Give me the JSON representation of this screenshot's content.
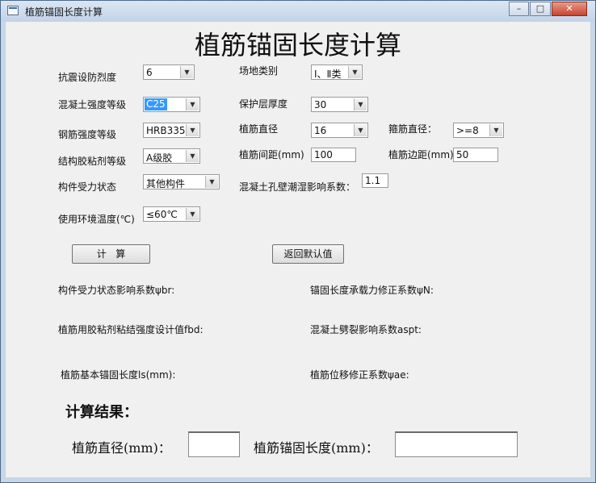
{
  "window": {
    "title": "植筋锚固长度计算",
    "min_glyph": "–",
    "max_glyph": "□",
    "close_glyph": "✕"
  },
  "form": {
    "heading": "植筋锚固长度计算",
    "fields": {
      "seismic": {
        "label": "抗震设防烈度",
        "value": "6"
      },
      "site": {
        "label": "场地类别",
        "value": "Ⅰ、Ⅱ类"
      },
      "concrete": {
        "label": "混凝土强度等级",
        "value": "C25"
      },
      "cover": {
        "label": "保护层厚度",
        "value": "30"
      },
      "steel": {
        "label": "钢筋强度等级",
        "value": "HRB335"
      },
      "bar_dia": {
        "label": "植筋直径",
        "value": "16"
      },
      "stirrup": {
        "label": "箍筋直径：",
        "value": ">=8"
      },
      "glue": {
        "label": "结构胶粘剂等级",
        "value": "A级胶"
      },
      "spacing": {
        "label": "植筋间距(mm)",
        "value": "100"
      },
      "edge": {
        "label": "植筋边距(mm)",
        "value": "50"
      },
      "member": {
        "label": "构件受力状态",
        "value": "其他构件"
      },
      "hole": {
        "label": "混凝土孔壁潮湿影响系数：",
        "value": "1.1"
      },
      "temp": {
        "label": "使用环境温度(℃)",
        "value": "≤60℃"
      }
    }
  },
  "buttons": {
    "calc": "计   算",
    "reset": "返回默认值"
  },
  "coefficients": {
    "psi_br": "构件受力状态影响系数ψbr:",
    "psi_n": "锚固长度承载力修正系数ψN:",
    "fbd": "植筋用胶粘剂粘结强度设计值fbd:",
    "aspt": "混凝土劈裂影响系数aspt:",
    "ls": "植筋基本锚固长度ls(mm):",
    "psi_ae": "植筋位移修正系数ψae:"
  },
  "result": {
    "heading": "计算结果：",
    "diameter_label": "植筋直径(mm)：",
    "diameter_value": "",
    "length_label": "植筋锚固长度(mm)：",
    "length_value": ""
  }
}
